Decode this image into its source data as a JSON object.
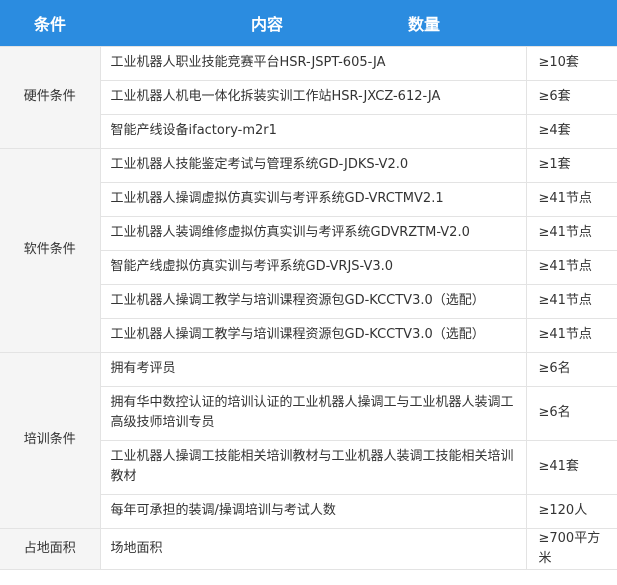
{
  "header": {
    "col_condition": "条件",
    "col_content": "内容",
    "col_quantity": "数量"
  },
  "groups": [
    {
      "category": "硬件条件",
      "rows": [
        {
          "content": "工业机器人职业技能竞赛平台HSR-JSPT-605-JA",
          "quantity": "≥10套"
        },
        {
          "content": "工业机器人机电一体化拆装实训工作站HSR-JXCZ-612-JA",
          "quantity": "≥6套"
        },
        {
          "content": "智能产线设备ifactory-m2r1",
          "quantity": "≥4套"
        }
      ]
    },
    {
      "category": "软件条件",
      "rows": [
        {
          "content": "工业机器人技能鉴定考试与管理系统GD-JDKS-V2.0",
          "quantity": "≥1套"
        },
        {
          "content": "工业机器人操调虚拟仿真实训与考评系统GD-VRCTMV2.1",
          "quantity": "≥41节点"
        },
        {
          "content": "工业机器人装调维修虚拟仿真实训与考评系统GDVRZTM-V2.0",
          "quantity": "≥41节点"
        },
        {
          "content": "智能产线虚拟仿真实训与考评系统GD-VRJS-V3.0",
          "quantity": "≥41节点"
        },
        {
          "content": "工业机器人操调工教学与培训课程资源包GD-KCCTV3.0（选配）",
          "quantity": "≥41节点"
        },
        {
          "content": "工业机器人操调工教学与培训课程资源包GD-KCCTV3.0（选配）",
          "quantity": "≥41节点"
        }
      ]
    },
    {
      "category": "培训条件",
      "rows": [
        {
          "content": "拥有考评员",
          "quantity": "≥6名"
        },
        {
          "content": "拥有华中数控认证的培训认证的工业机器人操调工与工业机器人装调工高级技师培训专员",
          "quantity": "≥6名"
        },
        {
          "content": "工业机器人操调工技能相关培训教材与工业机器人装调工技能相关培训教材",
          "quantity": "≥41套"
        },
        {
          "content": "每年可承担的装调/操调培训与考试人数",
          "quantity": "≥120人"
        }
      ]
    },
    {
      "category": "占地面积",
      "rows": [
        {
          "content": "场地面积",
          "quantity": "≥700平方米"
        }
      ]
    }
  ]
}
